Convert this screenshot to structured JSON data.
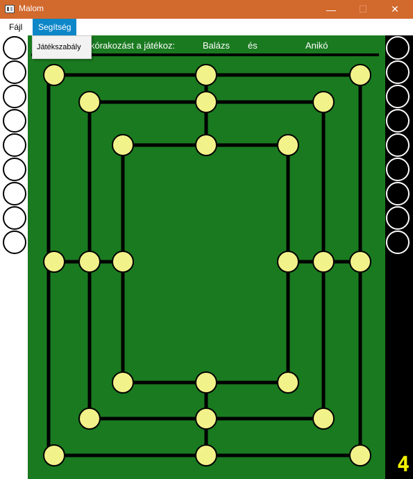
{
  "window": {
    "title": "Malom",
    "minimize": "—",
    "maximize": "☐",
    "close": "✕"
  },
  "menu": {
    "file": "Fájl",
    "help": "Segítség",
    "help_items": [
      "Játékszabály"
    ]
  },
  "status": {
    "text": "kórakozást a játékoz:",
    "player1": "Balázs",
    "and": "és",
    "player2": "Anikó"
  },
  "counter": "4",
  "colors": {
    "board": "#1a7a20",
    "point": "#f2f28a",
    "white_piece": "#ffffff",
    "black_piece": "#000000",
    "titlebar": "#d2692d",
    "menu_active": "#0e87c9",
    "counter": "#f2f200"
  },
  "reserve": {
    "white_count": 9,
    "black_count": 9
  },
  "board_points": [
    "a1",
    "d1",
    "g1",
    "b2",
    "d2",
    "f2",
    "c3",
    "d3",
    "e3",
    "a4",
    "b4",
    "c4",
    "e4",
    "f4",
    "g4",
    "c5",
    "d5",
    "e5",
    "b6",
    "d6",
    "f6",
    "a7",
    "d7",
    "g7"
  ]
}
